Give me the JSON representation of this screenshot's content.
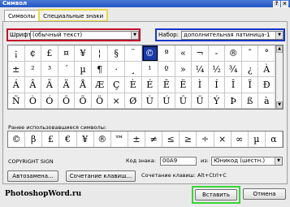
{
  "window": {
    "title": "Символ",
    "close_label": "×",
    "help_label": "?"
  },
  "tabs": [
    {
      "label": "Символы"
    },
    {
      "label": "Специальные знаки"
    }
  ],
  "font": {
    "label": "Шрифт:",
    "value": "(обычный текст)"
  },
  "subset": {
    "label": "Набор:",
    "value": "дополнительная латиница-1"
  },
  "grid": {
    "rows": [
      [
        "¡",
        "¢",
        "£",
        "¤",
        "¥",
        "¦",
        "§",
        "¨",
        "©",
        "ª",
        "«",
        "¬",
        "-",
        "®",
        "¯",
        "°"
      ],
      [
        "±",
        "²",
        "³",
        "´",
        "µ",
        "¶",
        "·",
        "¸",
        "¹",
        "º",
        "»",
        "¼",
        "½",
        "¾",
        "¿",
        "À"
      ],
      [
        "Á",
        "Â",
        "Ã",
        "Ä",
        "Å",
        "Æ",
        "Ç",
        "È",
        "É",
        "Ê",
        "Ë",
        "Ì",
        "Í",
        "Î",
        "Ï",
        "Ð"
      ],
      [
        "Ñ",
        "Ò",
        "Ó",
        "Ô",
        "Õ",
        "Ö",
        "×",
        "Ø",
        "Ù",
        "Ú",
        "Û",
        "Ü",
        "Ý",
        "Þ",
        "ß",
        "à"
      ]
    ]
  },
  "recent": {
    "label": "Ранее использовавшиеся символы:",
    "symbols": [
      "©",
      "β",
      "£",
      "€",
      "¥",
      "®",
      "™",
      "±",
      "≠",
      "≤",
      "≥",
      "÷",
      "×",
      "∞",
      "µ",
      "α"
    ]
  },
  "char_name": "COPYRIGHT SIGN",
  "code": {
    "label": "Код знака:",
    "value": "00A9",
    "from_label": "из:",
    "from_value": "Юникод (шестн.)"
  },
  "buttons": {
    "autocorrect": "Автозамена...",
    "shortcut_key": "Сочетание клавиш...",
    "insert": "Вставить",
    "cancel": "Отмена"
  },
  "shortcut_text": "Сочетание клавиш: Alt+Ctrl+C",
  "brand": "PhotoshopWord.ru",
  "colors": {
    "font_box": "#c0112b",
    "subset_box": "#1936c9",
    "tab_highlight": "#e8d84a",
    "insert_highlight": "#37d535",
    "selected_cell": "#1a3aa8"
  }
}
